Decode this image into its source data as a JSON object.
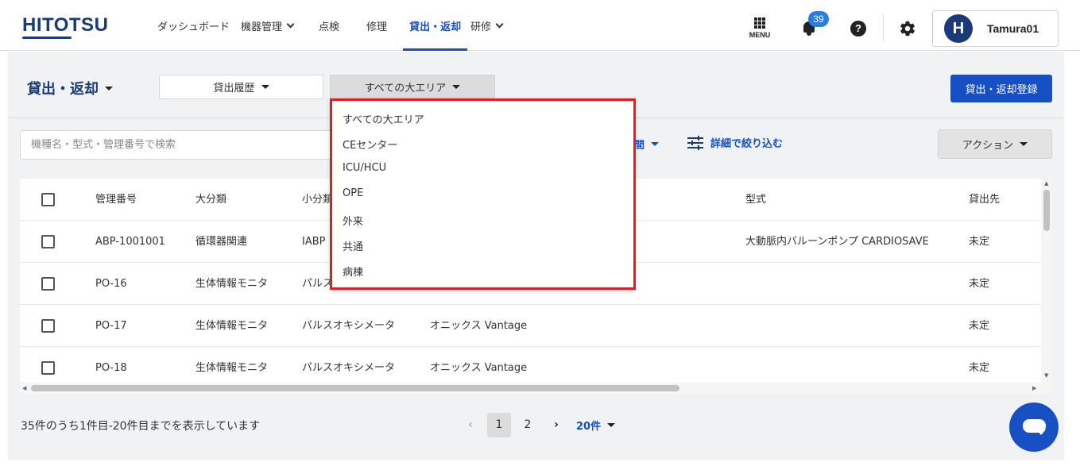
{
  "header": {
    "logo": "HITOTSU",
    "nav": [
      {
        "label": "ダッシュボード"
      },
      {
        "label": "機器管理"
      },
      {
        "label": "点検"
      },
      {
        "label": "修理"
      },
      {
        "label": "貸出・返却"
      },
      {
        "label": "研修"
      }
    ],
    "menu_label": "MENU",
    "notification_count": "39",
    "help_glyph": "?",
    "user": {
      "initial": "H",
      "name": "Tamura01"
    }
  },
  "page": {
    "title": "貸出・返却",
    "history_button": "貸出履歴",
    "area_button": "すべての大エリア",
    "register_button": "貸出・返却登録",
    "search_placeholder": "機種名・型式・管理番号で検索",
    "period_label": "間",
    "filter_label": "詳細で絞り込む",
    "action_button": "アクション"
  },
  "table": {
    "headers": [
      "管理番号",
      "大分類",
      "小分類",
      "型式",
      "貸出先"
    ],
    "rows": [
      {
        "id": "ABP-1001001",
        "major": "循環器関連",
        "minor": "IABP",
        "product": "",
        "model": "大動脈内バルーンポンプ CARDIOSAVE",
        "dest": "未定"
      },
      {
        "id": "PO-16",
        "major": "生体情報モニタ",
        "minor": "パルス",
        "product": "",
        "model": "",
        "dest": "未定"
      },
      {
        "id": "PO-17",
        "major": "生体情報モニタ",
        "minor": "パルスオキシメータ",
        "product": "オニックス Vantage",
        "model": "",
        "dest": "未定"
      },
      {
        "id": "PO-18",
        "major": "生体情報モニタ",
        "minor": "パルスオキシメータ",
        "product": "オニックス Vantage",
        "model": "",
        "dest": "未定"
      }
    ]
  },
  "area_dropdown": {
    "options": [
      "すべての大エリア",
      "CEセンター",
      "ICU/HCU",
      "OPE",
      "外来",
      "共通",
      "病棟"
    ]
  },
  "footer": {
    "summary": "35件のうち1件目-20件目までを表示しています",
    "prev": "‹",
    "pages": [
      "1",
      "2"
    ],
    "next": "›",
    "per_page": "20件"
  },
  "colors": {
    "brand": "#1a3a7a",
    "accent": "#1650c4",
    "highlight": "#e01e1e"
  }
}
